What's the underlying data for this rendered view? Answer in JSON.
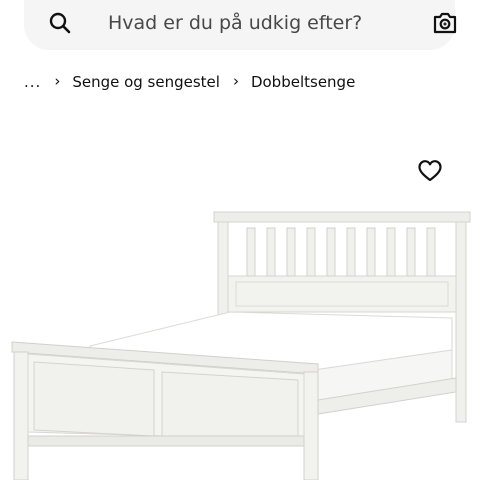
{
  "search": {
    "placeholder": "Hvad er du på udkig efter?",
    "value": "",
    "icon": "search-icon",
    "camera_icon": "camera-icon"
  },
  "breadcrumb": {
    "ellipsis": "...",
    "items": [
      {
        "label": "Senge og sengestel"
      },
      {
        "label": "Dobbeltsenge"
      }
    ],
    "separator": "›"
  },
  "product": {
    "image_subject": "white wooden double bed frame with slatted headboard and mattress",
    "favorite_icon": "heart-outline-icon"
  },
  "colors": {
    "search_bg": "#f5f5f5",
    "text": "#111111",
    "page_bg": "#ffffff"
  }
}
